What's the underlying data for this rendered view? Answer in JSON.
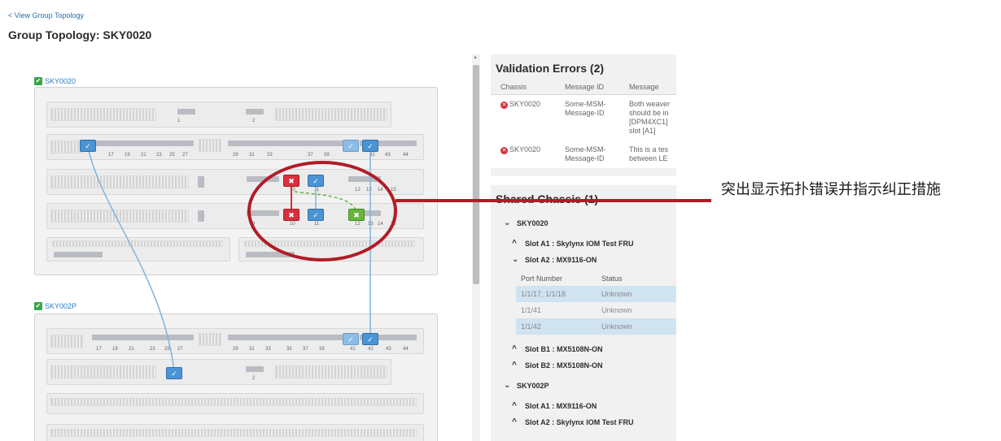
{
  "header": {
    "back_link": "< View Group Topology",
    "title": "Group Topology: SKY0020"
  },
  "topology": {
    "chassis": [
      {
        "name": "SKY0020"
      },
      {
        "name": "SKY002P"
      }
    ],
    "top_row_ports": [
      "1",
      "2"
    ],
    "sky0020_row2_ports": [
      "17",
      "19",
      "21",
      "23",
      "25",
      "27",
      "29",
      "31",
      "33",
      "37",
      "39",
      "42",
      "43",
      "44"
    ],
    "sky0020_row3_ports": [
      "10",
      "11",
      "12",
      "13",
      "14",
      "15"
    ],
    "sky0020_row4_ports": [
      "9",
      "10",
      "11",
      "12",
      "13",
      "14",
      "15"
    ],
    "sky002p_row1_ports": [
      "1",
      "2"
    ],
    "sky002p_row2_ports": [
      "17",
      "19",
      "21",
      "23",
      "25",
      "27",
      "29",
      "31",
      "33",
      "35",
      "37",
      "39",
      "41",
      "42",
      "43",
      "44"
    ],
    "sky002p_row3_ports": [
      "2"
    ],
    "colors": {
      "ok": "#4b94d4",
      "error": "#d9303d",
      "suggest": "#66b63e",
      "link": "#7fb3df"
    }
  },
  "validation": {
    "title": "Validation Errors (2)",
    "columns": [
      "Chassis",
      "Message ID",
      "Message"
    ],
    "rows": [
      {
        "chassis": "SKY0020",
        "message_id": "Some-MSM-Message-ID",
        "message": "Both weaver should be in [DPM4XC1] slot [A1]"
      },
      {
        "chassis": "SKY0020",
        "message_id": "Some-MSM-Message-ID",
        "message": "This is a tes between LE"
      }
    ]
  },
  "shared": {
    "title": "Shared Chassis (1)",
    "groups": [
      {
        "name": "SKY0020",
        "slots": [
          {
            "label": "Slot A1 : Skylynx IOM Test FRU"
          },
          {
            "label": "Slot A2 : MX9116-ON"
          },
          {
            "label": "Slot B1 : MX5108N-ON"
          },
          {
            "label": "Slot B2 : MX5108N-ON"
          }
        ]
      },
      {
        "name": "SKY002P",
        "slots": [
          {
            "label": "Slot A1 : MX9116-ON"
          },
          {
            "label": "Slot A2 : Skylynx IOM Test FRU"
          }
        ]
      }
    ],
    "ports_columns": [
      "Port Number",
      "Status"
    ],
    "ports": [
      {
        "port": "1/1/17, 1/1/18",
        "status": "Unknown"
      },
      {
        "port": "1/1/41",
        "status": "Unknown"
      },
      {
        "port": "1/1/42",
        "status": "Unknown"
      }
    ]
  },
  "callout": {
    "text": "突出显示拓扑错误并指示纠正措施"
  }
}
